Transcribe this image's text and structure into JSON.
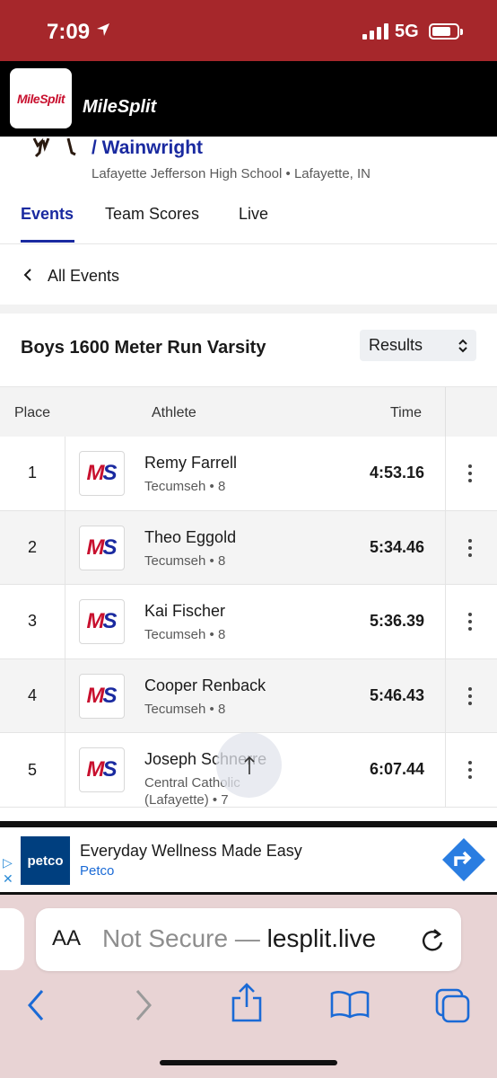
{
  "status_bar": {
    "time": "7:09",
    "network": "5G",
    "icons": [
      "location-arrow-icon",
      "signal-icon",
      "battery-icon"
    ]
  },
  "site": {
    "logo_text": "MileSplit",
    "brand_text": "MileSplit"
  },
  "meet": {
    "title": "/ Wainwright",
    "subtitle": "Lafayette Jefferson High School • Lafayette, IN"
  },
  "tabs": [
    {
      "label": "Events",
      "active": true
    },
    {
      "label": "Team Scores",
      "active": false
    },
    {
      "label": "Live",
      "active": false
    }
  ],
  "back_link": {
    "label": "All Events"
  },
  "event": {
    "title": "Boys 1600 Meter Run Varsity",
    "view_select": "Results"
  },
  "table": {
    "headers": {
      "place": "Place",
      "athlete": "Athlete",
      "time": "Time"
    },
    "logo_letters": {
      "m": "M",
      "s": "S"
    },
    "rows": [
      {
        "place": "1",
        "name": "Remy Farrell",
        "team": "Tecumseh • 8",
        "time": "4:53.16"
      },
      {
        "place": "2",
        "name": "Theo Eggold",
        "team": "Tecumseh • 8",
        "time": "5:34.46"
      },
      {
        "place": "3",
        "name": "Kai Fischer",
        "team": "Tecumseh • 8",
        "time": "5:36.39"
      },
      {
        "place": "4",
        "name": "Cooper Renback",
        "team": "Tecumseh • 8",
        "time": "5:46.43"
      },
      {
        "place": "5",
        "name": "Joseph Schnerre",
        "team": "Central Catholic (Lafayette) • 7",
        "time": "6:07.44"
      }
    ]
  },
  "ad": {
    "logo_text": "petco",
    "headline": "Everyday Wellness Made Easy",
    "brand": "Petco"
  },
  "browser": {
    "aa_label": "AA",
    "url_prefix": "Not Secure — ",
    "url_host": "lesplit.live"
  },
  "colors": {
    "status_bar": "#a6272b",
    "accent": "#1a2aa0",
    "brand_red": "#c8102e",
    "browser_chrome": "#e8d3d4"
  }
}
